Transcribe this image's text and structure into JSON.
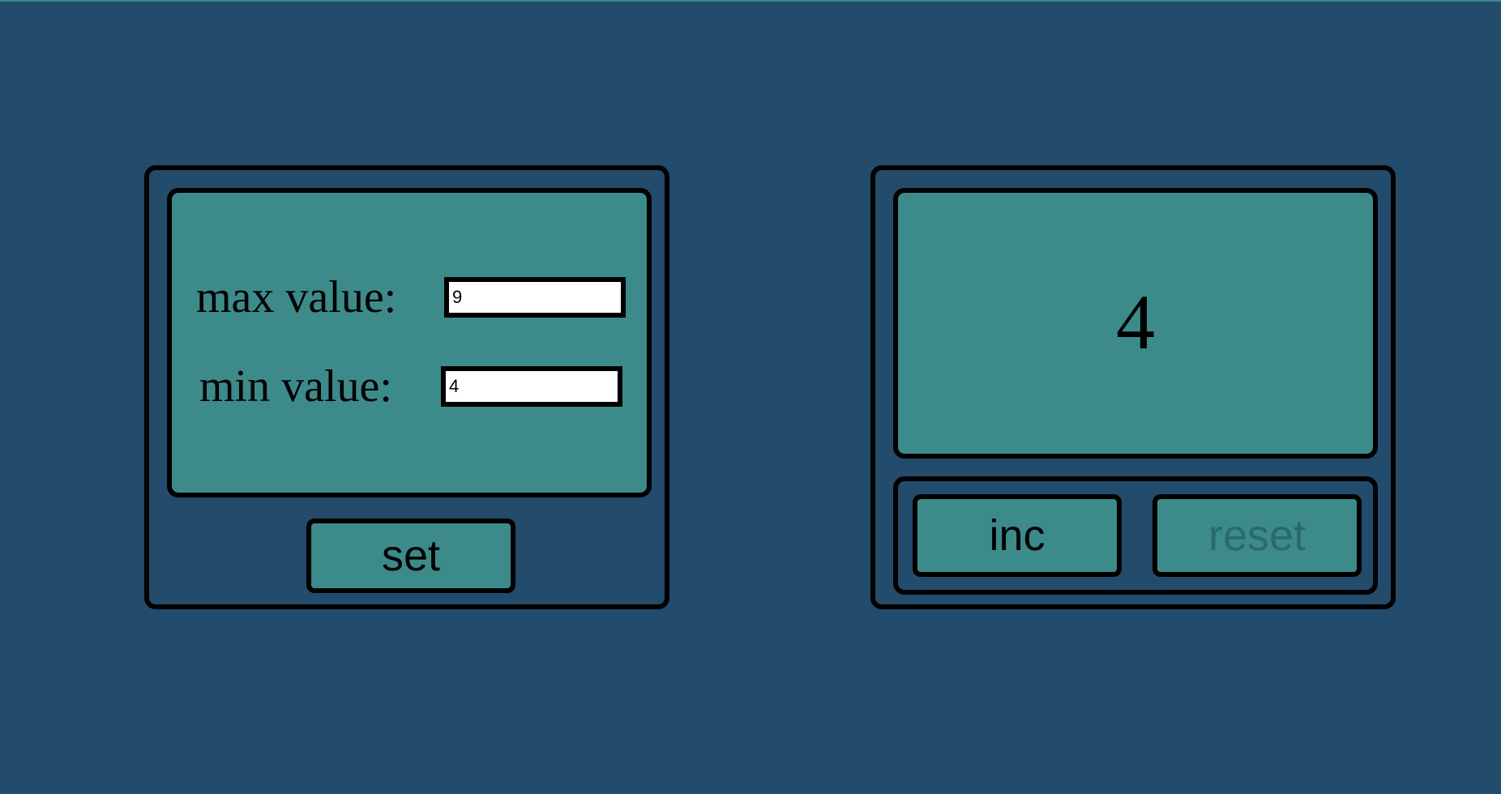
{
  "settings": {
    "max_label": "max value:",
    "max_value": "9",
    "min_label": "min value:",
    "min_value": "4",
    "set_label": "set"
  },
  "counter": {
    "value": "4",
    "inc_label": "inc",
    "reset_label": "reset",
    "reset_disabled": true
  },
  "colors": {
    "background": "#234b6b",
    "panel_fill": "#3d8a8a",
    "disabled_text": "#2b6a6a"
  }
}
